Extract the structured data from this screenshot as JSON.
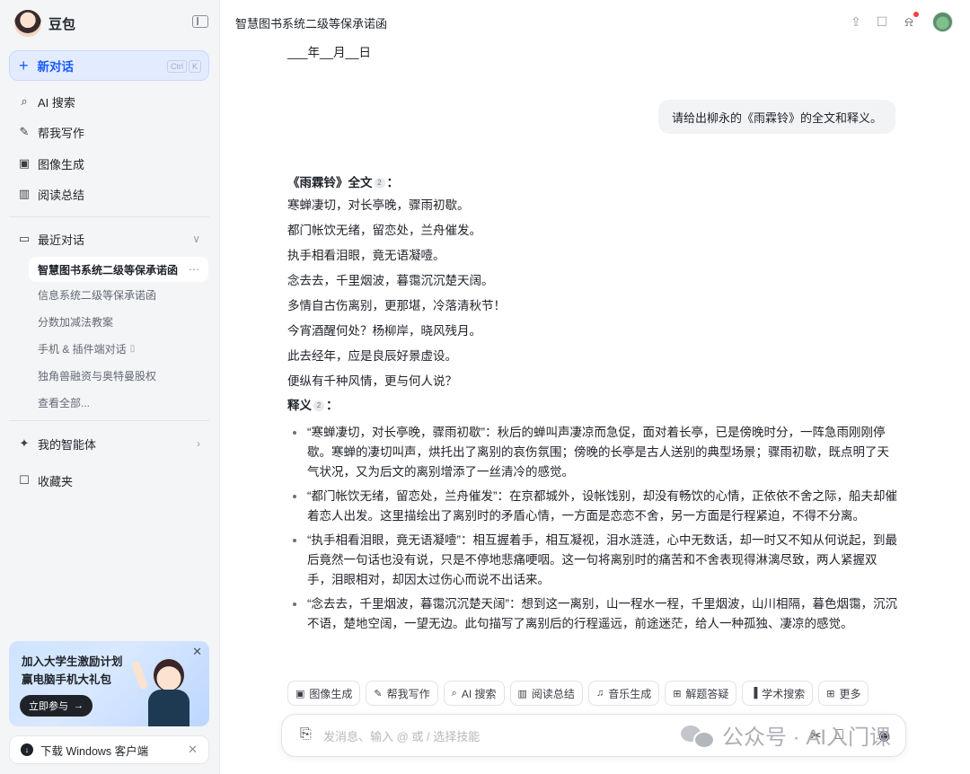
{
  "sidebar": {
    "brand": "豆包",
    "new_chat": {
      "label": "新对话",
      "shortcut": [
        "Ctrl",
        "K"
      ]
    },
    "tools": [
      {
        "label": "AI 搜索",
        "icon": "ai-search-icon"
      },
      {
        "label": "帮我写作",
        "icon": "pen-icon"
      },
      {
        "label": "图像生成",
        "icon": "image-icon"
      },
      {
        "label": "阅读总结",
        "icon": "book-icon"
      }
    ],
    "recent_section": {
      "label": "最近对话",
      "icon": "chat-bubble-icon"
    },
    "recent": [
      {
        "label": "智慧图书系统二级等保承诺函",
        "active": true
      },
      {
        "label": "信息系统二级等保承诺函"
      },
      {
        "label": "分数加减法教案"
      },
      {
        "label": "手机 & 插件端对话"
      },
      {
        "label": "独角兽融资与奥特曼股权"
      },
      {
        "label": "查看全部..."
      }
    ],
    "agents": {
      "label": "我的智能体",
      "icon": "sparkle-icon"
    },
    "favorites": {
      "label": "收藏夹",
      "icon": "bookmark-icon"
    },
    "promo": {
      "line1": "加入大学生激励计划",
      "line2": "赢电脑手机大礼包",
      "button": "立即参与"
    },
    "download": {
      "label": "下载 Windows 客户端"
    }
  },
  "header": {
    "title": "智慧图书系统二级等保承诺函"
  },
  "conversation": {
    "date_line": "___年__月__日",
    "user_message": "请给出柳永的《雨霖铃》的全文和释义。",
    "poem_heading": "《雨霖铃》全文",
    "poem_heading_suffix": "：",
    "citation_label": "2",
    "poem_lines": [
      "寒蝉凄切，对长亭晚，骤雨初歇。",
      "都门帐饮无绪，留恋处，兰舟催发。",
      "执手相看泪眼，竟无语凝噎。",
      "念去去，千里烟波，暮霭沉沉楚天阔。",
      "多情自古伤离别，更那堪，冷落清秋节！",
      "今宵酒醒何处？杨柳岸，晓风残月。",
      "此去经年，应是良辰好景虚设。",
      "便纵有千种风情，更与何人说？"
    ],
    "explain_heading": "释义",
    "explain_heading_suffix": "：",
    "explanations": [
      "“寒蝉凄切，对长亭晚，骤雨初歇”：秋后的蝉叫声凄凉而急促，面对着长亭，已是傍晚时分，一阵急雨刚刚停歇。寒蝉的凄切叫声，烘托出了离别的哀伤氛围；傍晚的长亭是古人送别的典型场景；骤雨初歇，既点明了天气状况，又为后文的离别增添了一丝清冷的感觉。",
      "“都门帐饮无绪，留恋处，兰舟催发”：在京都城外，设帐饯别，却没有畅饮的心情，正依依不舍之际，船夫却催着恋人出发。这里描绘出了离别时的矛盾心情，一方面是恋恋不舍，另一方面是行程紧迫，不得不分离。",
      "“执手相看泪眼，竟无语凝噎”：相互握着手，相互凝视，泪水涟涟，心中无数话，却一时又不知从何说起，到最后竟然一句话也没有说，只是不停地悲痛哽咽。这一句将离别时的痛苦和不舍表现得淋漓尽致，两人紧握双手，泪眼相对，却因太过伤心而说不出话来。",
      "“念去去，千里烟波，暮霭沉沉楚天阔”：想到这一离别，山一程水一程，千里烟波，山川相隔，暮色烟霭，沉沉不语，楚地空阔，一望无边。此句描写了离别后的行程遥远，前途迷茫，给人一种孤独、凄凉的感觉。"
    ]
  },
  "skills": [
    {
      "label": "图像生成",
      "icon": "image-icon"
    },
    {
      "label": "帮我写作",
      "icon": "pen-icon"
    },
    {
      "label": "AI 搜索",
      "icon": "ai-search-icon"
    },
    {
      "label": "阅读总结",
      "icon": "book-icon"
    },
    {
      "label": "音乐生成",
      "icon": "music-note-icon"
    },
    {
      "label": "解题答疑",
      "icon": "calculator-icon"
    },
    {
      "label": "学术搜索",
      "icon": "bar-chart-icon"
    },
    {
      "label": "更多",
      "icon": "grid-icon"
    }
  ],
  "input": {
    "placeholder": "发消息、输入 @ 或 / 选择技能"
  },
  "watermark": {
    "text": "公众号 · AI入门课"
  },
  "colors": {
    "accent": "#1a5cff",
    "sidebar_bg": "#f4f5f7",
    "bubble_bg": "#f2f3f5",
    "notification": "#f53f3f"
  }
}
